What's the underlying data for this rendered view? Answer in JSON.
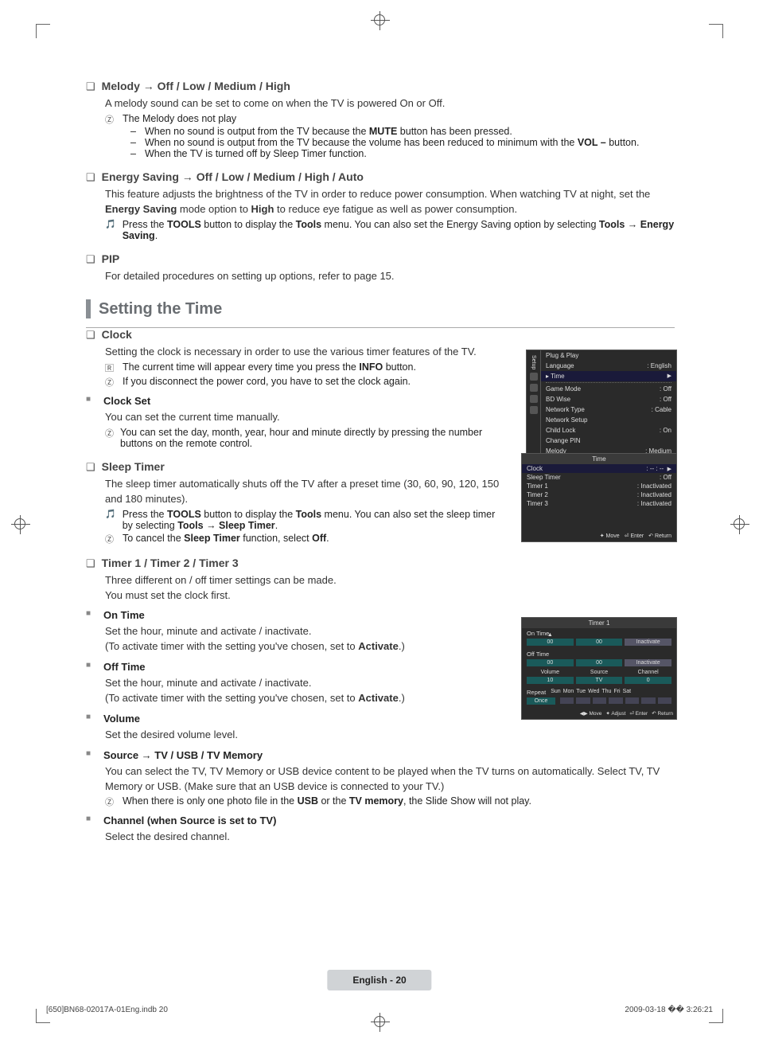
{
  "melody": {
    "title": "Melody → Off / Low / Medium / High",
    "desc": "A melody sound can be set to come on when the TV is powered On or Off.",
    "note1": "The Melody does not play",
    "b1a": "When no sound is output from the TV because the ",
    "b1b": "MUTE",
    "b1c": " button has been pressed.",
    "b2a": "When no sound is output from the TV because the volume has been reduced to minimum with the ",
    "b2b": "VOL –",
    "b2c": " button.",
    "b3": "When the TV is turned off by Sleep Timer function."
  },
  "energy": {
    "title": "Energy Saving → Off / Low / Medium / High / Auto",
    "desc_a": "This feature adjusts the brightness of the TV in order to reduce power consumption. When watching TV at night, set the ",
    "desc_b": "Energy Saving",
    "desc_c": " mode option to ",
    "desc_d": "High",
    "desc_e": " to reduce eye fatigue as well as power consumption.",
    "tool_a": "Press the ",
    "tool_b": "TOOLS",
    "tool_c": " button to display the ",
    "tool_d": "Tools",
    "tool_e": " menu. You can also set the Energy Saving option by selecting ",
    "tool_f": "Tools → Energy Saving",
    "tool_g": "."
  },
  "pip": {
    "title": "PIP",
    "desc": "For detailed procedures on setting up options, refer to page 15."
  },
  "section_time": "Setting the Time",
  "clock": {
    "title": "Clock",
    "desc": "Setting the clock is necessary in order to use the various timer features of the TV.",
    "n1a": "The current time will appear every time you press the ",
    "n1b": "INFO",
    "n1c": " button.",
    "n2": "If you disconnect the power cord, you have to set the clock again.",
    "set_title": "Clock Set",
    "set_desc": "You can set the current time manually.",
    "set_note": "You can set the day, month, year, hour and minute directly by pressing the number buttons on the remote control."
  },
  "sleep": {
    "title": "Sleep Timer",
    "desc": "The sleep timer automatically shuts off the TV after a preset time (30, 60, 90, 120, 150 and 180 minutes).",
    "t_a": "Press the ",
    "t_b": "TOOLS",
    "t_c": " button to display the ",
    "t_d": "Tools",
    "t_e": " menu. You can also set the sleep timer by selecting ",
    "t_f": "Tools → Sleep Timer",
    "t_g": ".",
    "c_a": "To cancel the ",
    "c_b": "Sleep Timer",
    "c_c": " function, select ",
    "c_d": "Off",
    "c_e": "."
  },
  "timers": {
    "title": "Timer 1 / Timer 2 / Timer 3",
    "d1": "Three different on / off timer settings can be made.",
    "d2": "You must set the clock first.",
    "on_title": "On Time",
    "on_1": "Set the hour, minute and activate / inactivate.",
    "on_2a": "(To activate timer with the setting you've chosen, set to ",
    "on_2b": "Activate",
    "on_2c": ".)",
    "off_title": "Off Time",
    "off_1": "Set the hour, minute and activate / inactivate.",
    "off_2a": "(To activate timer with the setting you've chosen, set to ",
    "off_2b": "Activate",
    "off_2c": ".)",
    "vol_title": "Volume",
    "vol_desc": "Set the desired volume level.",
    "src_title": "Source → TV / USB / TV Memory",
    "src_desc": "You can select the TV, TV Memory or USB device content to be played when the TV turns on automatically. Select TV, TV Memory or USB. (Make sure that an USB device is connected to your TV.)",
    "src_na": "When there is only one photo file in the ",
    "src_nb": "USB",
    "src_nc": " or the ",
    "src_nd": "TV memory",
    "src_ne": ", the Slide Show will not play.",
    "ch_title": "Channel (when Source is set to TV)",
    "ch_desc": "Select the desired channel."
  },
  "osd1": {
    "side": "Setup",
    "r1a": "Plug & Play",
    "r1b": "",
    "r2a": "Language",
    "r2b": ": English",
    "r3a": "Time",
    "r3b": "",
    "r4a": "Game Mode",
    "r4b": ": Off",
    "r5a": "BD Wise",
    "r5b": ": Off",
    "r6a": "Network Type",
    "r6b": ": Cable",
    "r7a": "Network Setup",
    "r7b": "",
    "r8a": "Child Lock",
    "r8b": ": On",
    "r9a": "Change PIN",
    "r9b": "",
    "r10a": "Melody",
    "r10b": ": Medium"
  },
  "osd2": {
    "title": "Time",
    "r1a": "Clock",
    "r1b": ": -- : --",
    "r2a": "Sleep Timer",
    "r2b": ": Off",
    "r3a": "Timer 1",
    "r3b": ": Inactivated",
    "r4a": "Timer 2",
    "r4b": ": Inactivated",
    "r5a": "Timer 3",
    "r5b": ": Inactivated",
    "lg1": "Move",
    "lg2": "Enter",
    "lg3": "Return"
  },
  "osd3": {
    "title": "Timer 1",
    "ontime": "On Time",
    "offtime": "Off Time",
    "h": "00",
    "m": "00",
    "st": "Inactivate",
    "vol": "Volume",
    "src": "Source",
    "ch": "Channel",
    "vv": "10",
    "sv": "TV",
    "cv": "0",
    "rep": "Repeat",
    "once": "Once",
    "d1": "Sun",
    "d2": "Mon",
    "d3": "Tue",
    "d4": "Wed",
    "d5": "Thu",
    "d6": "Fri",
    "d7": "Sat",
    "lg1": "Move",
    "lg2": "Adjust",
    "lg3": "Enter",
    "lg4": "Return"
  },
  "footer": {
    "label": "English - 20",
    "indb": "[650]BN68-02017A-01Eng.indb   20",
    "ts": "2009-03-18   �� 3:26:21"
  }
}
